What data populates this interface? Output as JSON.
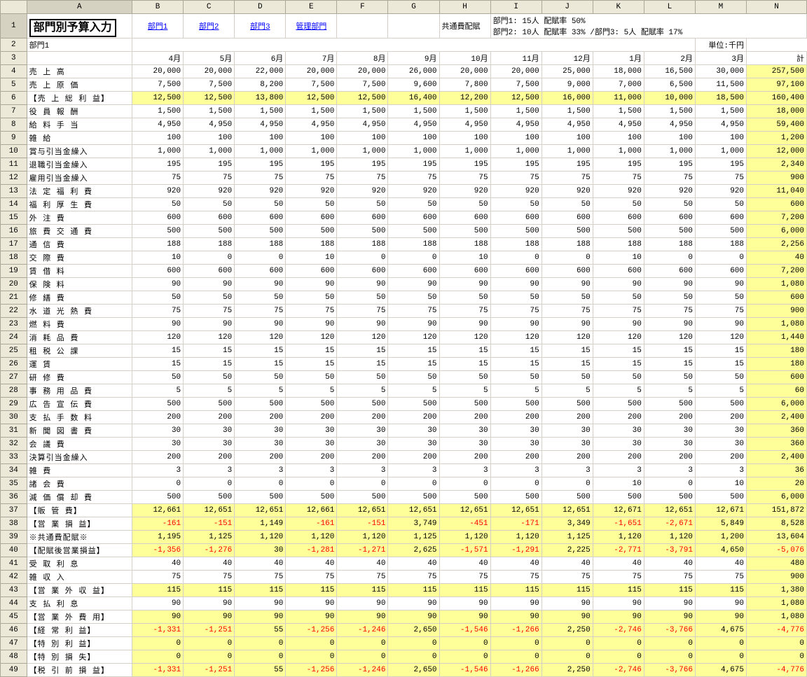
{
  "title": "部門別予算入力",
  "links": [
    "部門1",
    "部門2",
    "部門3",
    "管理部門"
  ],
  "alloc_label": "共通費配賦",
  "alloc_info": [
    "部門1:  15人   配賦率  50%",
    "部門2:  10人   配賦率  33%  /部門3:     5人  配賦率  17%"
  ],
  "subtitle": "部門1",
  "unit": "単位:千円",
  "col_letters": [
    "A",
    "B",
    "C",
    "D",
    "E",
    "F",
    "G",
    "H",
    "I",
    "J",
    "K",
    "L",
    "M",
    "N"
  ],
  "months": [
    "4月",
    "5月",
    "6月",
    "7月",
    "8月",
    "9月",
    "10月",
    "11月",
    "12月",
    "1月",
    "2月",
    "3月",
    "計"
  ],
  "rows": [
    {
      "n": 4,
      "label": "売  上  高",
      "v": [
        20000,
        20000,
        22000,
        20000,
        20000,
        26000,
        20000,
        20000,
        25000,
        18000,
        16500,
        30000,
        257500
      ]
    },
    {
      "n": 5,
      "label": "売 上 原 価",
      "v": [
        7500,
        7500,
        8200,
        7500,
        7500,
        9600,
        7800,
        7500,
        9000,
        7000,
        6500,
        11500,
        97100
      ]
    },
    {
      "n": 6,
      "label": "【売 上 総 利 益】",
      "yel": true,
      "v": [
        12500,
        12500,
        13800,
        12500,
        12500,
        16400,
        12200,
        12500,
        16000,
        11000,
        10000,
        18500,
        160400
      ]
    },
    {
      "n": 7,
      "label": "役 員 報 酬",
      "v": [
        1500,
        1500,
        1500,
        1500,
        1500,
        1500,
        1500,
        1500,
        1500,
        1500,
        1500,
        1500,
        18000
      ]
    },
    {
      "n": 8,
      "label": "給 料 手 当",
      "v": [
        4950,
        4950,
        4950,
        4950,
        4950,
        4950,
        4950,
        4950,
        4950,
        4950,
        4950,
        4950,
        59400
      ]
    },
    {
      "n": 9,
      "label": "雑      給",
      "v": [
        100,
        100,
        100,
        100,
        100,
        100,
        100,
        100,
        100,
        100,
        100,
        100,
        1200
      ]
    },
    {
      "n": 10,
      "label": "賞与引当金繰入",
      "v": [
        1000,
        1000,
        1000,
        1000,
        1000,
        1000,
        1000,
        1000,
        1000,
        1000,
        1000,
        1000,
        12000
      ]
    },
    {
      "n": 11,
      "label": "退職引当金繰入",
      "v": [
        195,
        195,
        195,
        195,
        195,
        195,
        195,
        195,
        195,
        195,
        195,
        195,
        2340
      ]
    },
    {
      "n": 12,
      "label": "雇用引当金繰入",
      "v": [
        75,
        75,
        75,
        75,
        75,
        75,
        75,
        75,
        75,
        75,
        75,
        75,
        900
      ]
    },
    {
      "n": 13,
      "label": "法 定 福 利 費",
      "v": [
        920,
        920,
        920,
        920,
        920,
        920,
        920,
        920,
        920,
        920,
        920,
        920,
        11040
      ]
    },
    {
      "n": 14,
      "label": "福 利 厚 生 費",
      "v": [
        50,
        50,
        50,
        50,
        50,
        50,
        50,
        50,
        50,
        50,
        50,
        50,
        600
      ]
    },
    {
      "n": 15,
      "label": "外  注  費",
      "v": [
        600,
        600,
        600,
        600,
        600,
        600,
        600,
        600,
        600,
        600,
        600,
        600,
        7200
      ]
    },
    {
      "n": 16,
      "label": "旅 費 交 通 費",
      "v": [
        500,
        500,
        500,
        500,
        500,
        500,
        500,
        500,
        500,
        500,
        500,
        500,
        6000
      ]
    },
    {
      "n": 17,
      "label": "通  信  費",
      "v": [
        188,
        188,
        188,
        188,
        188,
        188,
        188,
        188,
        188,
        188,
        188,
        188,
        2256
      ]
    },
    {
      "n": 18,
      "label": "交  際  費",
      "v": [
        10,
        0,
        0,
        10,
        0,
        0,
        10,
        0,
        0,
        10,
        0,
        0,
        40
      ]
    },
    {
      "n": 19,
      "label": "賃  借  料",
      "v": [
        600,
        600,
        600,
        600,
        600,
        600,
        600,
        600,
        600,
        600,
        600,
        600,
        7200
      ]
    },
    {
      "n": 20,
      "label": "保  険  料",
      "v": [
        90,
        90,
        90,
        90,
        90,
        90,
        90,
        90,
        90,
        90,
        90,
        90,
        1080
      ]
    },
    {
      "n": 21,
      "label": "修  繕  費",
      "v": [
        50,
        50,
        50,
        50,
        50,
        50,
        50,
        50,
        50,
        50,
        50,
        50,
        600
      ]
    },
    {
      "n": 22,
      "label": "水 道 光 熱 費",
      "v": [
        75,
        75,
        75,
        75,
        75,
        75,
        75,
        75,
        75,
        75,
        75,
        75,
        900
      ]
    },
    {
      "n": 23,
      "label": "燃  料  費",
      "v": [
        90,
        90,
        90,
        90,
        90,
        90,
        90,
        90,
        90,
        90,
        90,
        90,
        1080
      ]
    },
    {
      "n": 24,
      "label": "消 耗 品 費",
      "v": [
        120,
        120,
        120,
        120,
        120,
        120,
        120,
        120,
        120,
        120,
        120,
        120,
        1440
      ]
    },
    {
      "n": 25,
      "label": "租 税 公 課",
      "v": [
        15,
        15,
        15,
        15,
        15,
        15,
        15,
        15,
        15,
        15,
        15,
        15,
        180
      ]
    },
    {
      "n": 26,
      "label": "運    賃",
      "v": [
        15,
        15,
        15,
        15,
        15,
        15,
        15,
        15,
        15,
        15,
        15,
        15,
        180
      ]
    },
    {
      "n": 27,
      "label": "研  修  費",
      "v": [
        50,
        50,
        50,
        50,
        50,
        50,
        50,
        50,
        50,
        50,
        50,
        50,
        600
      ]
    },
    {
      "n": 28,
      "label": "事 務 用 品 費",
      "v": [
        5,
        5,
        5,
        5,
        5,
        5,
        5,
        5,
        5,
        5,
        5,
        5,
        60
      ]
    },
    {
      "n": 29,
      "label": "広 告 宣 伝 費",
      "v": [
        500,
        500,
        500,
        500,
        500,
        500,
        500,
        500,
        500,
        500,
        500,
        500,
        6000
      ]
    },
    {
      "n": 30,
      "label": "支 払 手 数 料",
      "v": [
        200,
        200,
        200,
        200,
        200,
        200,
        200,
        200,
        200,
        200,
        200,
        200,
        2400
      ]
    },
    {
      "n": 31,
      "label": "新 聞 図 書 費",
      "v": [
        30,
        30,
        30,
        30,
        30,
        30,
        30,
        30,
        30,
        30,
        30,
        30,
        360
      ]
    },
    {
      "n": 32,
      "label": "会  議  費",
      "v": [
        30,
        30,
        30,
        30,
        30,
        30,
        30,
        30,
        30,
        30,
        30,
        30,
        360
      ]
    },
    {
      "n": 33,
      "label": "決算引当金繰入",
      "v": [
        200,
        200,
        200,
        200,
        200,
        200,
        200,
        200,
        200,
        200,
        200,
        200,
        2400
      ]
    },
    {
      "n": 34,
      "label": "雑    費",
      "v": [
        3,
        3,
        3,
        3,
        3,
        3,
        3,
        3,
        3,
        3,
        3,
        3,
        36
      ]
    },
    {
      "n": 35,
      "label": "諸  会  費",
      "v": [
        0,
        0,
        0,
        0,
        0,
        0,
        0,
        0,
        0,
        10,
        0,
        10,
        20
      ]
    },
    {
      "n": 36,
      "label": "減 価 償 却 費",
      "v": [
        500,
        500,
        500,
        500,
        500,
        500,
        500,
        500,
        500,
        500,
        500,
        500,
        6000
      ]
    },
    {
      "n": 37,
      "label": "【販  管  費】",
      "yel": true,
      "v": [
        12661,
        12651,
        12651,
        12661,
        12651,
        12651,
        12651,
        12651,
        12651,
        12671,
        12651,
        12671,
        151872
      ]
    },
    {
      "n": 38,
      "label": "【営  業  損  益】",
      "yel": true,
      "v": [
        -161,
        -151,
        1149,
        -161,
        -151,
        3749,
        -451,
        -171,
        3349,
        -1651,
        -2671,
        5849,
        8528
      ]
    },
    {
      "n": 39,
      "label": "※共通費配賦※",
      "yel": true,
      "v": [
        1195,
        1125,
        1120,
        1120,
        1120,
        1125,
        1120,
        1120,
        1125,
        1120,
        1120,
        1200,
        13604
      ]
    },
    {
      "n": 40,
      "label": "【配賦後営業損益】",
      "yel": true,
      "v": [
        -1356,
        -1276,
        30,
        -1281,
        -1271,
        2625,
        -1571,
        -1291,
        2225,
        -2771,
        -3791,
        4650,
        -5076
      ]
    },
    {
      "n": 41,
      "label": "受 取 利 息",
      "v": [
        40,
        40,
        40,
        40,
        40,
        40,
        40,
        40,
        40,
        40,
        40,
        40,
        480
      ]
    },
    {
      "n": 42,
      "label": "雑  収  入",
      "v": [
        75,
        75,
        75,
        75,
        75,
        75,
        75,
        75,
        75,
        75,
        75,
        75,
        900
      ]
    },
    {
      "n": 43,
      "label": "【営 業 外 収 益】",
      "yel": true,
      "v": [
        115,
        115,
        115,
        115,
        115,
        115,
        115,
        115,
        115,
        115,
        115,
        115,
        1380
      ]
    },
    {
      "n": 44,
      "label": "支 払 利 息",
      "v": [
        90,
        90,
        90,
        90,
        90,
        90,
        90,
        90,
        90,
        90,
        90,
        90,
        1080
      ]
    },
    {
      "n": 45,
      "label": "【営 業 外 費 用】",
      "yel": true,
      "v": [
        90,
        90,
        90,
        90,
        90,
        90,
        90,
        90,
        90,
        90,
        90,
        90,
        1080
      ]
    },
    {
      "n": 46,
      "label": "【経  常  利  益】",
      "yel": true,
      "v": [
        -1331,
        -1251,
        55,
        -1256,
        -1246,
        2650,
        -1546,
        -1266,
        2250,
        -2746,
        -3766,
        4675,
        -4776
      ]
    },
    {
      "n": 47,
      "label": "【特 別 利 益】",
      "yel": true,
      "v": [
        0,
        0,
        0,
        0,
        0,
        0,
        0,
        0,
        0,
        0,
        0,
        0,
        0
      ]
    },
    {
      "n": 48,
      "label": "【特 別 損 失】",
      "yel": true,
      "v": [
        0,
        0,
        0,
        0,
        0,
        0,
        0,
        0,
        0,
        0,
        0,
        0,
        0
      ]
    },
    {
      "n": 49,
      "label": "【税 引 前 損 益】",
      "yel": true,
      "v": [
        -1331,
        -1251,
        55,
        -1256,
        -1246,
        2650,
        -1546,
        -1266,
        2250,
        -2746,
        -3766,
        4675,
        -4776
      ]
    }
  ]
}
